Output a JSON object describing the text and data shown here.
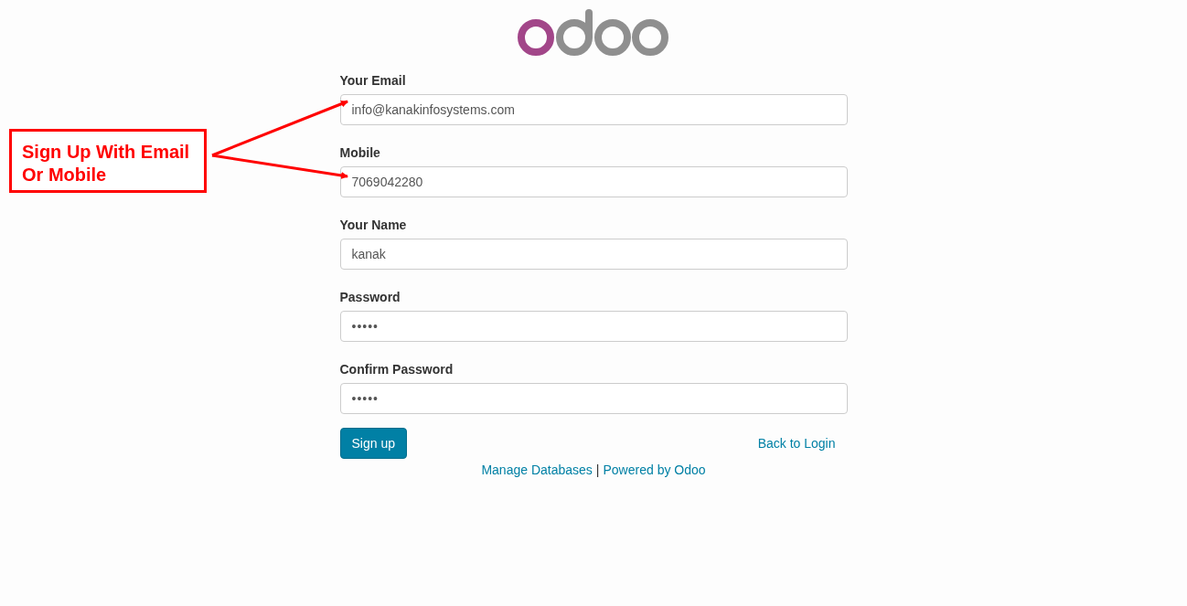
{
  "fields": [
    {
      "label": "Your Email",
      "value": "info@kanakinfosystems.com",
      "kind": "text"
    },
    {
      "label": "Mobile",
      "value": "7069042280",
      "kind": "text"
    },
    {
      "label": "Your Name",
      "value": "kanak",
      "kind": "text"
    },
    {
      "label": "Password",
      "value": "•••••",
      "kind": "password"
    },
    {
      "label": "Confirm Password",
      "value": "•••••",
      "kind": "password"
    }
  ],
  "submit_button": "Sign up",
  "back_link": "Back to Login",
  "footer": {
    "manage_link": "Manage Databases",
    "separator": "|",
    "powered_link": "Powered by Odoo"
  },
  "annotation": {
    "text": "Sign Up With Email Or Mobile"
  }
}
